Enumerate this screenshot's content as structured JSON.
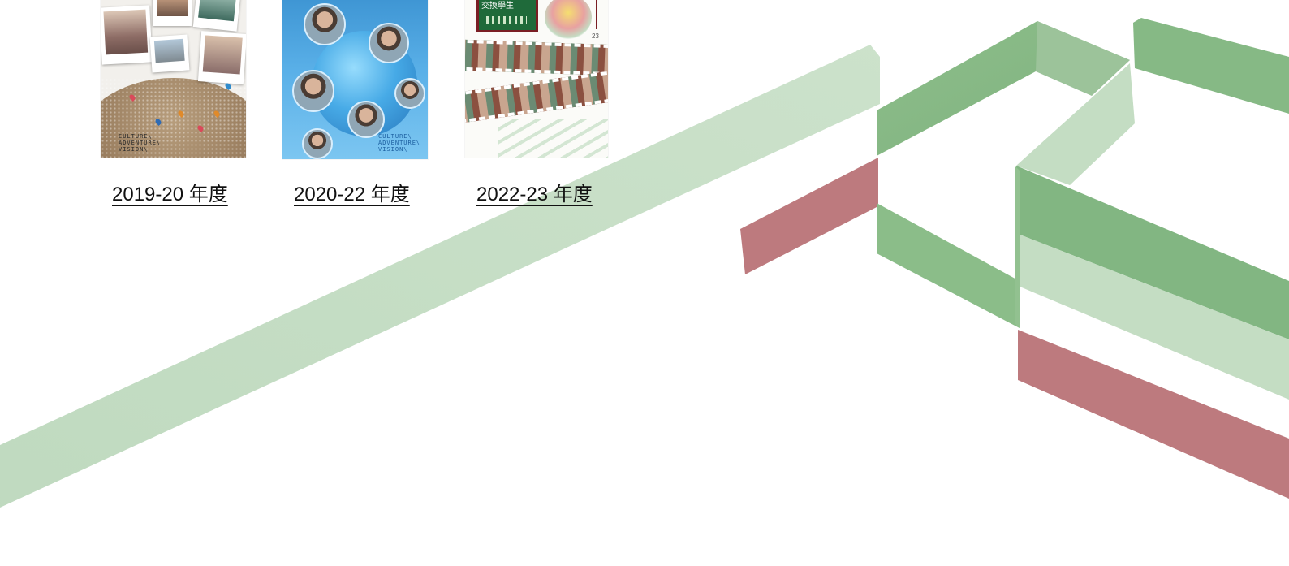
{
  "colors": {
    "ribbon_green_light": "#c3dcc3",
    "ribbon_green_mid": "#87b886",
    "ribbon_red": "#b8777b",
    "text": "#111111"
  },
  "cards": [
    {
      "year_label": "2019-20 年度",
      "cover_tagline": "CULTURE\\\nADVENTURE\\\nVISION\\"
    },
    {
      "year_label": "2020-22 年度",
      "cover_tagline": "CULTURE\\\nADVENTURE\\\nVISION\\"
    },
    {
      "year_label": "2022-23 年度",
      "cover_title": "交換學生",
      "cover_page_number": "23"
    }
  ]
}
